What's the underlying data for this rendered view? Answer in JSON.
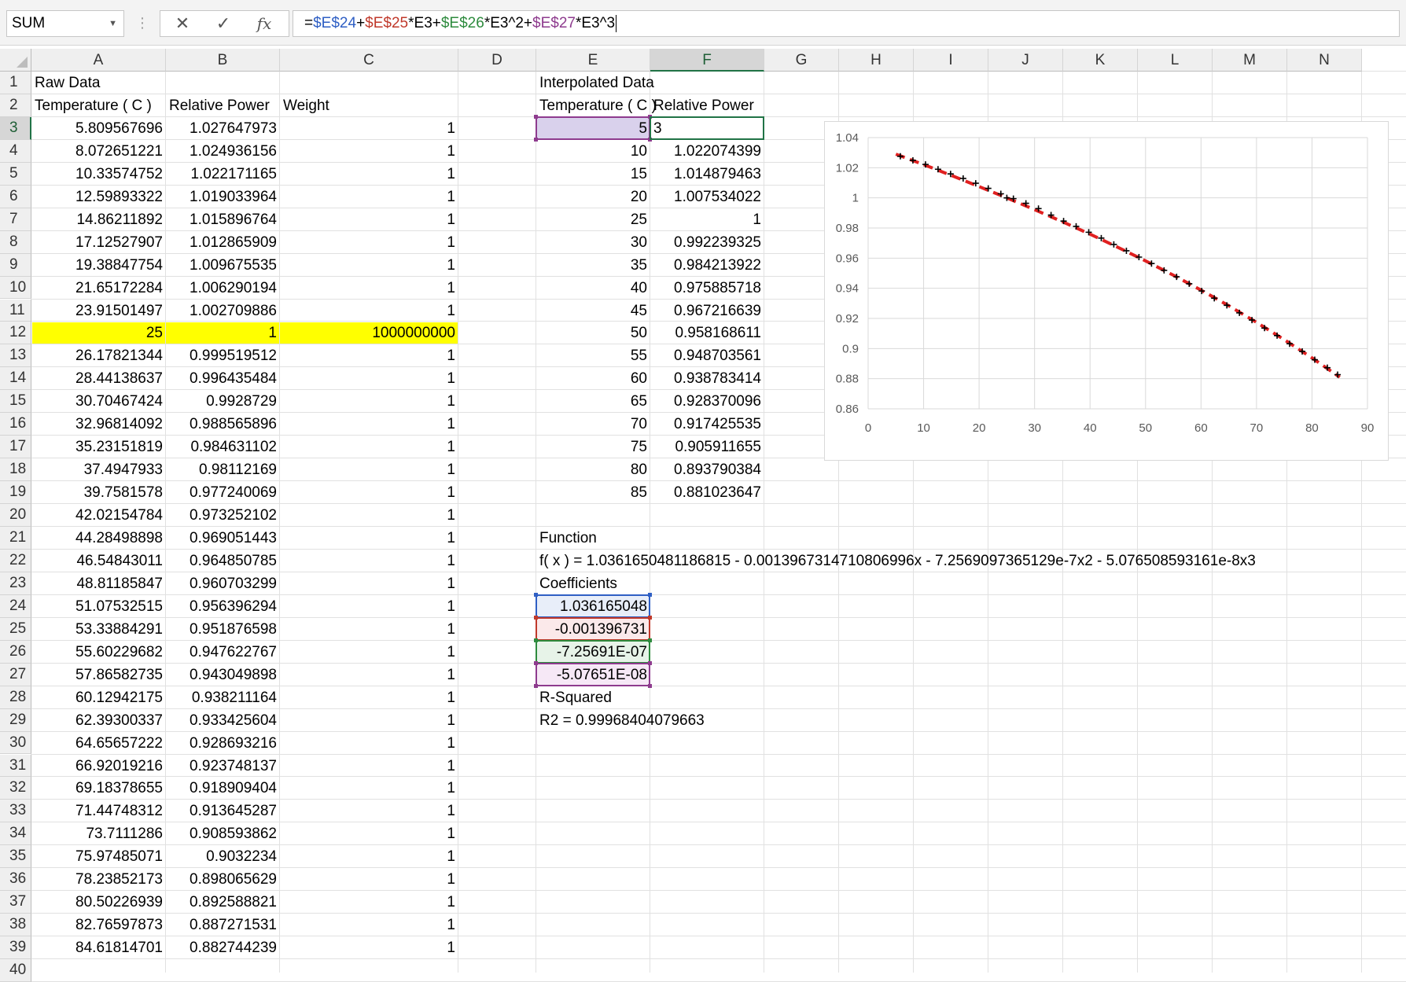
{
  "formula_bar": {
    "name_box": "SUM",
    "cancel_icon": "✕",
    "enter_icon": "✓",
    "fx_label": "fx",
    "formula_parts": [
      {
        "text": "=",
        "color": "#000000"
      },
      {
        "text": "$E$24",
        "color": "#2f5fc4"
      },
      {
        "text": "+",
        "color": "#000000"
      },
      {
        "text": "$E$25",
        "color": "#c0392b"
      },
      {
        "text": "*E3+",
        "color": "#000000"
      },
      {
        "text": "$E$26",
        "color": "#2e8b3e"
      },
      {
        "text": "*E3^2+",
        "color": "#000000"
      },
      {
        "text": "$E$27",
        "color": "#8e3b8e"
      },
      {
        "text": "*E3^3",
        "color": "#000000"
      }
    ]
  },
  "columns": [
    "A",
    "B",
    "C",
    "D",
    "E",
    "F",
    "G",
    "H",
    "I",
    "J",
    "K",
    "L",
    "M",
    "N"
  ],
  "selected_column": "F",
  "selected_row": "3",
  "rows": [
    "1",
    "2",
    "3",
    "4",
    "5",
    "6",
    "7",
    "8",
    "9",
    "10",
    "11",
    "12",
    "13",
    "14",
    "15",
    "16",
    "17",
    "18",
    "19",
    "20",
    "21",
    "22",
    "23",
    "24",
    "25",
    "26",
    "27",
    "28",
    "29",
    "30",
    "31",
    "32",
    "33",
    "34",
    "35",
    "36",
    "37",
    "38",
    "39",
    "40"
  ],
  "raw": {
    "title": "Raw Data",
    "headers": [
      "Temperature ( C )",
      "Relative Power",
      "Weight"
    ],
    "temperature": [
      "5.809567696",
      "8.072651221",
      "10.33574752",
      "12.59893322",
      "14.86211892",
      "17.12527907",
      "19.38847754",
      "21.65172284",
      "23.91501497",
      "25",
      "26.17821344",
      "28.44138637",
      "30.70467424",
      "32.96814092",
      "35.23151819",
      "37.4947933",
      "39.7581578",
      "42.02154784",
      "44.28498898",
      "46.54843011",
      "48.81185847",
      "51.07532515",
      "53.33884291",
      "55.60229682",
      "57.86582735",
      "60.12942175",
      "62.39300337",
      "64.65657222",
      "66.92019216",
      "69.18378655",
      "71.44748312",
      "73.7111286",
      "75.97485071",
      "78.23852173",
      "80.50226939",
      "82.76597873",
      "84.61814701"
    ],
    "power": [
      "1.027647973",
      "1.024936156",
      "1.022171165",
      "1.019033964",
      "1.015896764",
      "1.012865909",
      "1.009675535",
      "1.006290194",
      "1.002709886",
      "1",
      "0.999519512",
      "0.996435484",
      "0.9928729",
      "0.988565896",
      "0.984631102",
      "0.98112169",
      "0.977240069",
      "0.973252102",
      "0.969051443",
      "0.964850785",
      "0.960703299",
      "0.956396294",
      "0.951876598",
      "0.947622767",
      "0.943049898",
      "0.938211164",
      "0.933425604",
      "0.928693216",
      "0.923748137",
      "0.918909404",
      "0.913645287",
      "0.908593862",
      "0.9032234",
      "0.898065629",
      "0.892588821",
      "0.887271531",
      "0.882744239"
    ],
    "weight": [
      "1",
      "1",
      "1",
      "1",
      "1",
      "1",
      "1",
      "1",
      "1",
      "1000000000",
      "1",
      "1",
      "1",
      "1",
      "1",
      "1",
      "1",
      "1",
      "1",
      "1",
      "1",
      "1",
      "1",
      "1",
      "1",
      "1",
      "1",
      "1",
      "1",
      "1",
      "1",
      "1",
      "1",
      "1",
      "1",
      "1",
      "1"
    ]
  },
  "interp": {
    "title": "Interpolated Data",
    "headers": [
      "Temperature ( C )",
      "Relative Power"
    ],
    "temperature": [
      "5",
      "10",
      "15",
      "20",
      "25",
      "30",
      "35",
      "40",
      "45",
      "50",
      "55",
      "60",
      "65",
      "70",
      "75",
      "80",
      "85"
    ],
    "power": [
      "3",
      "1.022074399",
      "1.014879463",
      "1.007534022",
      "1",
      "0.992239325",
      "0.984213922",
      "0.975885718",
      "0.967216639",
      "0.958168611",
      "0.948703561",
      "0.938783414",
      "0.928370096",
      "0.917425535",
      "0.905911655",
      "0.893790384",
      "0.881023647"
    ]
  },
  "function": {
    "label": "Function",
    "expression": "f( x ) = 1.0361650481186815 - 0.0013967314710806996x - 7.2569097365129e-7x2 - 5.076508593161e-8x3",
    "coefficients_label": "Coefficients",
    "coefficients": [
      "1.036165048",
      "-0.001396731",
      "-7.25691E-07",
      "-5.07651E-08"
    ],
    "coefficient_colors": [
      "#2f5fc4",
      "#c0392b",
      "#2e8b3e",
      "#8e3b8e"
    ],
    "r_squared_label": "R-Squared",
    "r_squared": "R2 = 0.99968404079663"
  },
  "colors": {
    "highlight_row": "#ffff00",
    "active_cell_border": "#217346",
    "e3_fill": "#d9d1ec",
    "trend_line": "#e02020",
    "markers": "#000000"
  },
  "chart_data": {
    "type": "scatter",
    "title": "",
    "xlabel": "",
    "ylabel": "",
    "xlim": [
      0,
      90
    ],
    "ylim": [
      0.86,
      1.04
    ],
    "x_ticks": [
      "0",
      "10",
      "20",
      "30",
      "40",
      "50",
      "60",
      "70",
      "80",
      "90"
    ],
    "y_ticks": [
      "1.04",
      "1.02",
      "1",
      "0.98",
      "0.96",
      "0.94",
      "0.92",
      "0.9",
      "0.88",
      "0.86"
    ],
    "grid": true,
    "series": [
      {
        "style": "markers-plus",
        "x": [
          5.81,
          8.07,
          10.34,
          12.6,
          14.86,
          17.13,
          19.39,
          21.65,
          23.92,
          25,
          26.18,
          28.44,
          30.7,
          32.97,
          35.23,
          37.49,
          39.76,
          42.02,
          44.28,
          46.55,
          48.81,
          51.08,
          53.34,
          55.6,
          57.87,
          60.13,
          62.39,
          64.66,
          66.92,
          69.18,
          71.45,
          73.71,
          75.97,
          78.24,
          80.5,
          82.77,
          84.62
        ],
        "y": [
          1.0276,
          1.0249,
          1.0222,
          1.019,
          1.0159,
          1.0129,
          1.0097,
          1.0063,
          1.0027,
          1.0,
          0.9995,
          0.9964,
          0.9929,
          0.9886,
          0.9846,
          0.9811,
          0.9772,
          0.9733,
          0.9691,
          0.9649,
          0.9607,
          0.9564,
          0.9519,
          0.9476,
          0.943,
          0.9382,
          0.9334,
          0.9287,
          0.9237,
          0.9189,
          0.9136,
          0.9086,
          0.9032,
          0.8981,
          0.8926,
          0.8873,
          0.8827
        ]
      },
      {
        "style": "dashed-line",
        "x": [
          5,
          10,
          15,
          20,
          25,
          30,
          35,
          40,
          45,
          50,
          55,
          60,
          65,
          70,
          75,
          80,
          85
        ],
        "y": [
          1.029,
          1.0221,
          1.0149,
          1.0075,
          1.0,
          0.9922,
          0.9842,
          0.9759,
          0.9672,
          0.9582,
          0.9487,
          0.9388,
          0.9284,
          0.9174,
          0.9059,
          0.8938,
          0.881
        ]
      }
    ]
  }
}
